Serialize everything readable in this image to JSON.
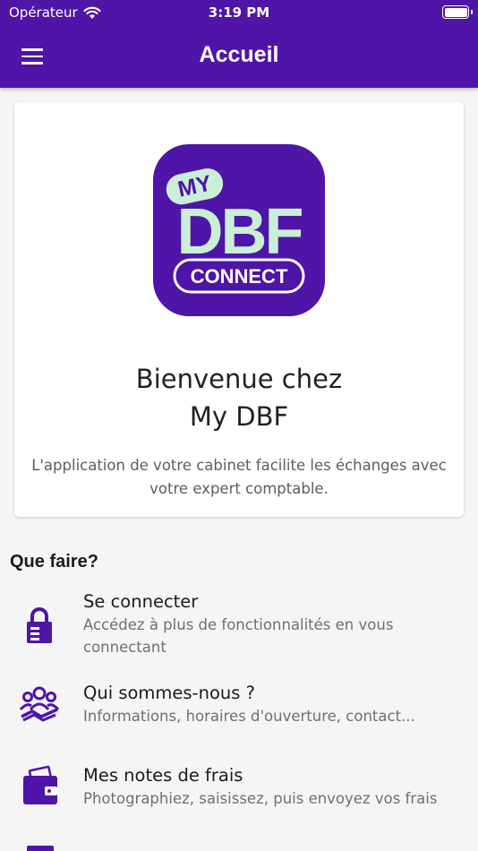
{
  "status_bar": {
    "carrier": "Opérateur",
    "time": "3:19 PM"
  },
  "header": {
    "title": "Accueil"
  },
  "card": {
    "logo_text": {
      "top": "MY",
      "main": "DBF",
      "bottom": "CONNECT"
    },
    "welcome_line1": "Bienvenue chez",
    "welcome_line2": "My DBF",
    "description": "L'application de votre cabinet facilite les échanges avec votre expert comptable."
  },
  "section_title": "Que faire?",
  "actions": [
    {
      "title": "Se connecter",
      "subtitle": "Accédez à plus de fonctionnalités en vous connectant",
      "icon": "lock-icon"
    },
    {
      "title": "Qui sommes-nous ?",
      "subtitle": "Informations, horaires d'ouverture, contact...",
      "icon": "team-icon"
    },
    {
      "title": "Mes notes de frais",
      "subtitle": "Photographiez, saisissez, puis envoyez vos frais",
      "icon": "wallet-icon"
    }
  ],
  "colors": {
    "brand": "#4f14a8",
    "logo_mint": "#c9f0d6",
    "background": "#f5f5f6"
  }
}
